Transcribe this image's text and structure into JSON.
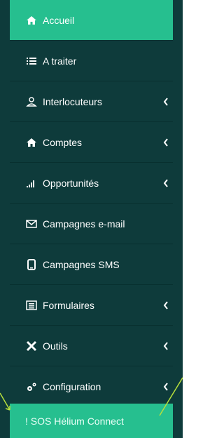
{
  "sidebar": {
    "items": [
      {
        "label": "Accueil",
        "icon": "home-icon"
      },
      {
        "label": "A traiter",
        "icon": "list-icon"
      },
      {
        "label": "Interlocuteurs",
        "icon": "user-icon"
      },
      {
        "label": "Comptes",
        "icon": "home-icon"
      },
      {
        "label": "Opportunités",
        "icon": "signal-icon"
      },
      {
        "label": "Campagnes e-mail",
        "icon": "envelope-icon"
      },
      {
        "label": "Campagnes SMS",
        "icon": "phone-icon"
      },
      {
        "label": "Formulaires",
        "icon": "form-icon"
      },
      {
        "label": "Outils",
        "icon": "tools-icon"
      },
      {
        "label": "Configuration",
        "icon": "gears-icon"
      },
      {
        "label": "! SOS Hélium Connect",
        "icon": ""
      }
    ],
    "colors": {
      "background": "#0e3b3b",
      "accent": "#26bf8f",
      "annotation": "#b7e03c"
    }
  }
}
